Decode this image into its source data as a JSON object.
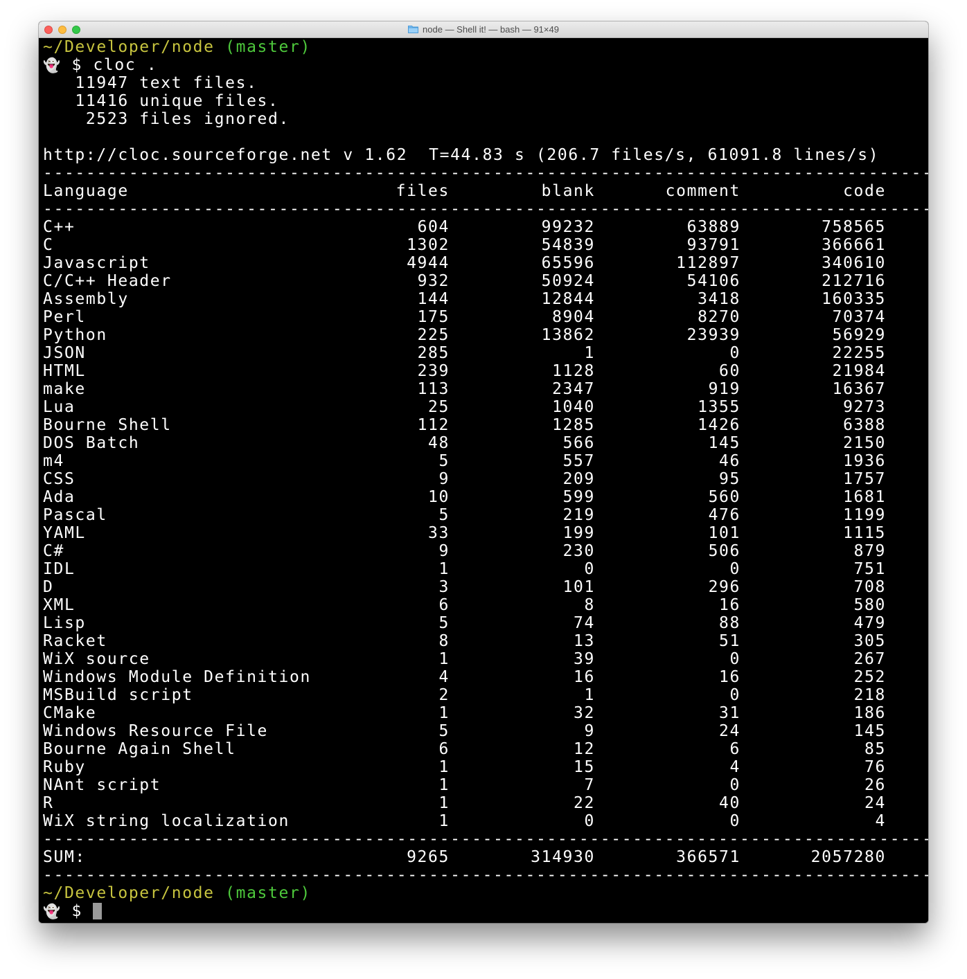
{
  "window": {
    "title": "node — Shell it! — bash — 91×49"
  },
  "prompt1": {
    "path": "~/Developer/node",
    "branch": "(master)",
    "symbol": "👻",
    "command": "$ cloc ."
  },
  "summary": {
    "line1": "   11947 text files.",
    "line2": "   11416 unique files.",
    "line3": "    2523 files ignored."
  },
  "header_line": "http://cloc.sourceforge.net v 1.62  T=44.83 s (206.7 files/s, 61091.8 lines/s)",
  "separator": "-------------------------------------------------------------------------------------------",
  "columns": {
    "language": "Language",
    "files": "files",
    "blank": "blank",
    "comment": "comment",
    "code": "code"
  },
  "rows": [
    {
      "language": "C++",
      "files": "604",
      "blank": "99232",
      "comment": "63889",
      "code": "758565"
    },
    {
      "language": "C",
      "files": "1302",
      "blank": "54839",
      "comment": "93791",
      "code": "366661"
    },
    {
      "language": "Javascript",
      "files": "4944",
      "blank": "65596",
      "comment": "112897",
      "code": "340610"
    },
    {
      "language": "C/C++ Header",
      "files": "932",
      "blank": "50924",
      "comment": "54106",
      "code": "212716"
    },
    {
      "language": "Assembly",
      "files": "144",
      "blank": "12844",
      "comment": "3418",
      "code": "160335"
    },
    {
      "language": "Perl",
      "files": "175",
      "blank": "8904",
      "comment": "8270",
      "code": "70374"
    },
    {
      "language": "Python",
      "files": "225",
      "blank": "13862",
      "comment": "23939",
      "code": "56929"
    },
    {
      "language": "JSON",
      "files": "285",
      "blank": "1",
      "comment": "0",
      "code": "22255"
    },
    {
      "language": "HTML",
      "files": "239",
      "blank": "1128",
      "comment": "60",
      "code": "21984"
    },
    {
      "language": "make",
      "files": "113",
      "blank": "2347",
      "comment": "919",
      "code": "16367"
    },
    {
      "language": "Lua",
      "files": "25",
      "blank": "1040",
      "comment": "1355",
      "code": "9273"
    },
    {
      "language": "Bourne Shell",
      "files": "112",
      "blank": "1285",
      "comment": "1426",
      "code": "6388"
    },
    {
      "language": "DOS Batch",
      "files": "48",
      "blank": "566",
      "comment": "145",
      "code": "2150"
    },
    {
      "language": "m4",
      "files": "5",
      "blank": "557",
      "comment": "46",
      "code": "1936"
    },
    {
      "language": "CSS",
      "files": "9",
      "blank": "209",
      "comment": "95",
      "code": "1757"
    },
    {
      "language": "Ada",
      "files": "10",
      "blank": "599",
      "comment": "560",
      "code": "1681"
    },
    {
      "language": "Pascal",
      "files": "5",
      "blank": "219",
      "comment": "476",
      "code": "1199"
    },
    {
      "language": "YAML",
      "files": "33",
      "blank": "199",
      "comment": "101",
      "code": "1115"
    },
    {
      "language": "C#",
      "files": "9",
      "blank": "230",
      "comment": "506",
      "code": "879"
    },
    {
      "language": "IDL",
      "files": "1",
      "blank": "0",
      "comment": "0",
      "code": "751"
    },
    {
      "language": "D",
      "files": "3",
      "blank": "101",
      "comment": "296",
      "code": "708"
    },
    {
      "language": "XML",
      "files": "6",
      "blank": "8",
      "comment": "16",
      "code": "580"
    },
    {
      "language": "Lisp",
      "files": "5",
      "blank": "74",
      "comment": "88",
      "code": "479"
    },
    {
      "language": "Racket",
      "files": "8",
      "blank": "13",
      "comment": "51",
      "code": "305"
    },
    {
      "language": "WiX source",
      "files": "1",
      "blank": "39",
      "comment": "0",
      "code": "267"
    },
    {
      "language": "Windows Module Definition",
      "files": "4",
      "blank": "16",
      "comment": "16",
      "code": "252"
    },
    {
      "language": "MSBuild script",
      "files": "2",
      "blank": "1",
      "comment": "0",
      "code": "218"
    },
    {
      "language": "CMake",
      "files": "1",
      "blank": "32",
      "comment": "31",
      "code": "186"
    },
    {
      "language": "Windows Resource File",
      "files": "5",
      "blank": "9",
      "comment": "24",
      "code": "145"
    },
    {
      "language": "Bourne Again Shell",
      "files": "6",
      "blank": "12",
      "comment": "6",
      "code": "85"
    },
    {
      "language": "Ruby",
      "files": "1",
      "blank": "15",
      "comment": "4",
      "code": "76"
    },
    {
      "language": "NAnt script",
      "files": "1",
      "blank": "7",
      "comment": "0",
      "code": "26"
    },
    {
      "language": "R",
      "files": "1",
      "blank": "22",
      "comment": "40",
      "code": "24"
    },
    {
      "language": "WiX string localization",
      "files": "1",
      "blank": "0",
      "comment": "0",
      "code": "4"
    }
  ],
  "sum": {
    "language": "SUM:",
    "files": "9265",
    "blank": "314930",
    "comment": "366571",
    "code": "2057280"
  },
  "prompt2": {
    "path": "~/Developer/node",
    "branch": "(master)",
    "symbol": "👻",
    "command": "$ "
  },
  "colors": {
    "path": "#c7c43f",
    "branch": "#4ec93c",
    "background": "#000000",
    "text": "#ffffff"
  }
}
